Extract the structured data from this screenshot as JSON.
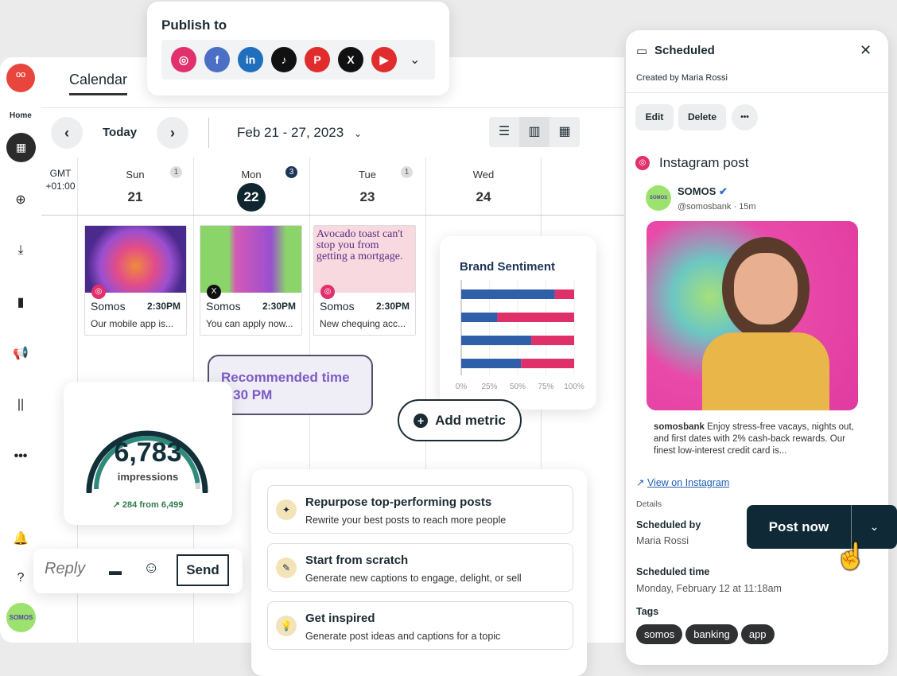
{
  "publish": {
    "title": "Publish to",
    "networks": [
      {
        "name": "instagram",
        "glyph": "◎",
        "color": "#e1306c"
      },
      {
        "name": "facebook",
        "glyph": "f",
        "color": "#4a6fc4"
      },
      {
        "name": "linkedin",
        "glyph": "in",
        "color": "#1f6fbd"
      },
      {
        "name": "tiktok",
        "glyph": "♪",
        "color": "#111111"
      },
      {
        "name": "pinterest",
        "glyph": "P",
        "color": "#e02c2c"
      },
      {
        "name": "x",
        "glyph": "X",
        "color": "#111111"
      },
      {
        "name": "youtube",
        "glyph": "▶",
        "color": "#e02c2c"
      }
    ]
  },
  "sidebar": {
    "home_label": "Home",
    "avatar_text": "SOMOS"
  },
  "calendar": {
    "tab": "Calendar",
    "today": "Today",
    "range": "Feb 21 - 27, 2023",
    "tz": "GMT",
    "tz_offset": "+01:00",
    "days": [
      {
        "name": "Sun",
        "num": "21",
        "count": "1"
      },
      {
        "name": "Mon",
        "num": "22",
        "count": "3",
        "active": true
      },
      {
        "name": "Tue",
        "num": "23",
        "count": "1"
      },
      {
        "name": "Wed",
        "num": "24"
      }
    ],
    "posts": [
      {
        "account": "Somos",
        "time": "2:30PM",
        "text": "Our mobile app is...",
        "network": "instagram"
      },
      {
        "account": "Somos",
        "time": "2:30PM",
        "text": "You can apply now...",
        "network": "x"
      },
      {
        "account": "Somos",
        "time": "2:30PM",
        "text": "New chequing acc...",
        "network": "instagram",
        "image_text": "Avocado toast can't stop you from getting a mortgage."
      }
    ]
  },
  "recommended": {
    "label": "Recommended time",
    "time": "2:30 PM"
  },
  "add_metric": "Add metric",
  "impressions": {
    "value": "6,783",
    "label": "impressions",
    "delta": "284 from 6,499",
    "progress": 0.96
  },
  "reply": {
    "placeholder": "Reply",
    "send": "Send"
  },
  "suggestions": [
    {
      "title": "Repurpose top-performing posts",
      "desc": "Rewrite your best posts to reach more people",
      "icon": "magic-wand"
    },
    {
      "title": "Start from scratch",
      "desc": "Generate new captions to engage, delight, or sell",
      "icon": "pencil"
    },
    {
      "title": "Get inspired",
      "desc": "Generate post ideas and captions for a topic",
      "icon": "lightbulb"
    }
  ],
  "chart_data": {
    "type": "bar",
    "orientation": "horizontal",
    "stacked": true,
    "title": "Brand Sentiment",
    "x_ticks": [
      "0%",
      "25%",
      "50%",
      "75%",
      "100%"
    ],
    "xlim": [
      0,
      100
    ],
    "grid": true,
    "series": [
      {
        "color": "#2f5fa8",
        "values": [
          83,
          32,
          62,
          53
        ]
      },
      {
        "color": "#e0306a",
        "values": [
          17,
          68,
          38,
          47
        ]
      }
    ]
  },
  "panel": {
    "title": "Scheduled",
    "created_by": "Created by Maria Rossi",
    "edit": "Edit",
    "delete": "Delete",
    "more": "•••",
    "post_type": "Instagram post",
    "account": "SOMOS",
    "handle": "@somosbank · 15m",
    "caption_user": "somosbank",
    "caption": " Enjoy stress-free vacays, nights out, and first dates with 2% cash-back rewards. Our finest low-interest credit card is...",
    "view_link": "View on Instagram",
    "details": "Details",
    "scheduled_by_label": "Scheduled by",
    "scheduled_by": "Maria Rossi",
    "scheduled_time_label": "Scheduled time",
    "scheduled_time": "Monday, February 12 at 11:18am",
    "tags_label": "Tags",
    "tags": [
      "somos",
      "banking",
      "app"
    ],
    "post_now": "Post now"
  }
}
